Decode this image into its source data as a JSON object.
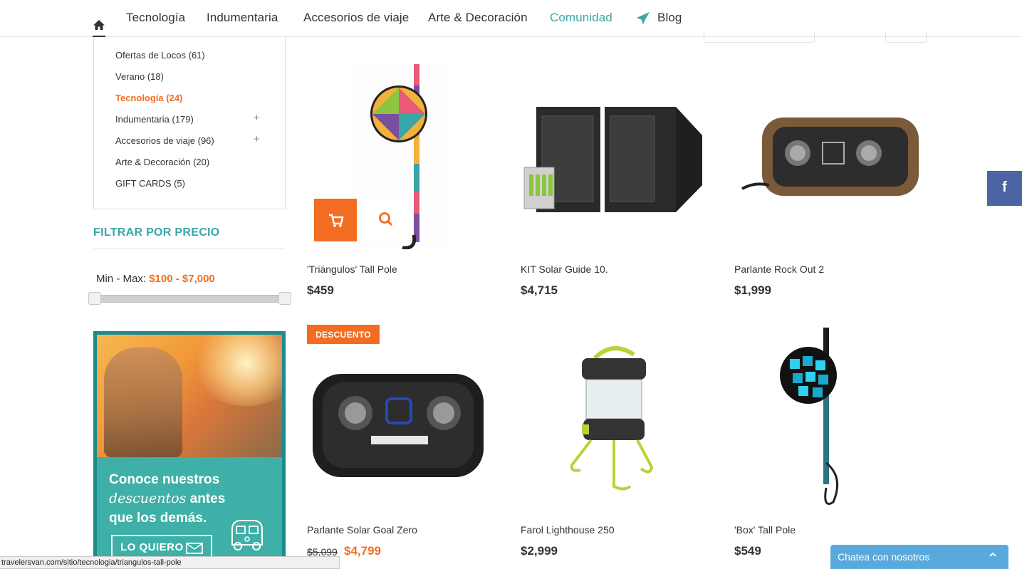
{
  "nav": {
    "items": [
      "Tecnología",
      "Indumentaria",
      "Accesorios de viaje",
      "Arte & Decoración",
      "Comunidad",
      "Blog"
    ],
    "active": "Comunidad"
  },
  "sidebar": {
    "categories": [
      {
        "label": "Ofertas de Locos (61)",
        "active": false
      },
      {
        "label": "Verano (18)",
        "active": false
      },
      {
        "label": "Tecnología (24)",
        "active": true
      },
      {
        "label": "Indumentaria (179)",
        "active": false,
        "expandable": true
      },
      {
        "label": "Accesorios de viaje (96)",
        "active": false,
        "expandable": true
      },
      {
        "label": "Arte & Decoración (20)",
        "active": false
      },
      {
        "label": "GIFT CARDS (5)",
        "active": false
      }
    ],
    "plus_glyph": "+",
    "filter_title": "FILTRAR POR PRECIO",
    "range_prefix": "Min - Max: ",
    "range_value": "$100 - $7,000"
  },
  "banner": {
    "line1": "Conoce nuestros",
    "line2_italic": "descuentos",
    "line2_rest": " antes",
    "line3": "que los demás.",
    "button": "LO QUIERO"
  },
  "products": [
    {
      "name": "'Triángulos' Tall Pole",
      "price": "$459"
    },
    {
      "name": "KIT Solar Guide 10.",
      "price": "$4,715"
    },
    {
      "name": "Parlante Rock Out 2",
      "price": "$1,999"
    },
    {
      "name": "Parlante Solar Goal Zero",
      "old_price": "$5,099",
      "price": "$4,799",
      "badge": "DESCUENTO"
    },
    {
      "name": "Farol Lighthouse 250",
      "price": "$2,999"
    },
    {
      "name": "'Box' Tall Pole",
      "price": "$549"
    }
  ],
  "social": {
    "facebook": "f"
  },
  "chat": {
    "label": "Chatea con nosotros",
    "chevron": "^"
  },
  "status_url": "travelersvan.com/sitio/tecnologia/triangulos-tall-pole",
  "colors": {
    "accent_orange": "#f26d21",
    "accent_teal": "#3aa6a7",
    "facebook": "#4a65a1",
    "chat": "#5aa9dc"
  }
}
